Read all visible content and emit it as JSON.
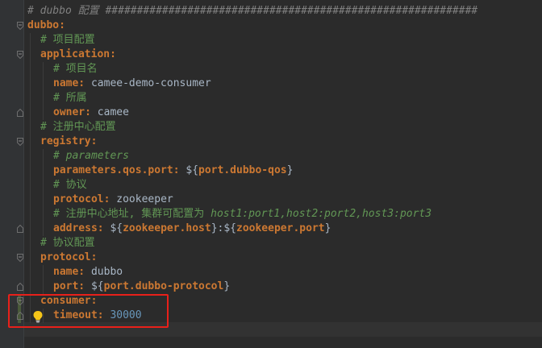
{
  "editor": {
    "language": "yaml",
    "lines": [
      {
        "indent": 0,
        "fold": "none",
        "parts": [
          {
            "t": "# dubbo ",
            "c": "comment-gray"
          },
          {
            "t": "配置",
            "c": "comment-gray"
          },
          {
            "t": " ###########################################################",
            "c": "comment-gray"
          }
        ]
      },
      {
        "indent": 0,
        "fold": "open",
        "parts": [
          {
            "t": "dubbo:",
            "c": "key"
          }
        ]
      },
      {
        "indent": 1,
        "fold": "none",
        "parts": [
          {
            "t": "# 项目配置",
            "c": "comment"
          }
        ]
      },
      {
        "indent": 1,
        "fold": "open",
        "parts": [
          {
            "t": "application:",
            "c": "key"
          }
        ]
      },
      {
        "indent": 2,
        "fold": "none",
        "parts": [
          {
            "t": "# 项目名",
            "c": "comment"
          }
        ]
      },
      {
        "indent": 2,
        "fold": "none",
        "parts": [
          {
            "t": "name:",
            "c": "key"
          },
          {
            "t": " camee-demo-consumer",
            "c": "val"
          }
        ]
      },
      {
        "indent": 2,
        "fold": "none",
        "parts": [
          {
            "t": "# 所属",
            "c": "comment"
          }
        ]
      },
      {
        "indent": 2,
        "fold": "end",
        "parts": [
          {
            "t": "owner:",
            "c": "key"
          },
          {
            "t": " camee",
            "c": "val"
          }
        ]
      },
      {
        "indent": 1,
        "fold": "none",
        "parts": [
          {
            "t": "# 注册中心配置",
            "c": "comment"
          }
        ]
      },
      {
        "indent": 1,
        "fold": "open",
        "parts": [
          {
            "t": "registry:",
            "c": "key"
          }
        ]
      },
      {
        "indent": 2,
        "fold": "none",
        "parts": [
          {
            "t": "# parameters",
            "c": "comment-it"
          }
        ]
      },
      {
        "indent": 2,
        "fold": "none",
        "parts": [
          {
            "t": "parameters.qos.port:",
            "c": "key"
          },
          {
            "t": " ${",
            "c": "brace"
          },
          {
            "t": "port.dubbo-qos",
            "c": "ph-key"
          },
          {
            "t": "}",
            "c": "brace"
          }
        ]
      },
      {
        "indent": 2,
        "fold": "none",
        "parts": [
          {
            "t": "# 协议",
            "c": "comment"
          }
        ]
      },
      {
        "indent": 2,
        "fold": "none",
        "parts": [
          {
            "t": "protocol:",
            "c": "key"
          },
          {
            "t": " zookeeper",
            "c": "val"
          }
        ]
      },
      {
        "indent": 2,
        "fold": "none",
        "parts": [
          {
            "t": "# 注册中心地址, 集群可配置为 ",
            "c": "comment"
          },
          {
            "t": "host1:port1,host2:port2,host3:port3",
            "c": "comment-it"
          }
        ]
      },
      {
        "indent": 2,
        "fold": "end",
        "parts": [
          {
            "t": "address:",
            "c": "key"
          },
          {
            "t": " ${",
            "c": "brace"
          },
          {
            "t": "zookeeper.host",
            "c": "ph-key"
          },
          {
            "t": "}:${",
            "c": "brace"
          },
          {
            "t": "zookeeper.port",
            "c": "ph-key"
          },
          {
            "t": "}",
            "c": "brace"
          }
        ]
      },
      {
        "indent": 1,
        "fold": "none",
        "parts": [
          {
            "t": "# 协议配置",
            "c": "comment"
          }
        ]
      },
      {
        "indent": 1,
        "fold": "open",
        "parts": [
          {
            "t": "protocol:",
            "c": "key"
          }
        ]
      },
      {
        "indent": 2,
        "fold": "none",
        "parts": [
          {
            "t": "name:",
            "c": "key"
          },
          {
            "t": " dubbo",
            "c": "val"
          }
        ]
      },
      {
        "indent": 2,
        "fold": "end",
        "parts": [
          {
            "t": "port:",
            "c": "key"
          },
          {
            "t": " ${",
            "c": "brace"
          },
          {
            "t": "port.dubbo-protocol",
            "c": "ph-key"
          },
          {
            "t": "}",
            "c": "brace"
          }
        ]
      },
      {
        "indent": 1,
        "fold": "open",
        "parts": [
          {
            "t": "consumer:",
            "c": "key"
          }
        ]
      },
      {
        "indent": 2,
        "fold": "end",
        "parts": [
          {
            "t": "timeout:",
            "c": "key"
          },
          {
            "t": " 30000",
            "c": "num"
          }
        ]
      },
      {
        "indent": 0,
        "fold": "none",
        "parts": []
      }
    ]
  },
  "annotation": {
    "box_color": "#e8201a",
    "highlighted": "consumer timeout block"
  },
  "intention_icon": "lightbulb-icon",
  "colors": {
    "background": "#2b2b2b",
    "gutter": "#313335",
    "yaml_key": "#cc7832",
    "comment": "#629755",
    "number": "#6897bb",
    "text": "#a9b7c6"
  }
}
